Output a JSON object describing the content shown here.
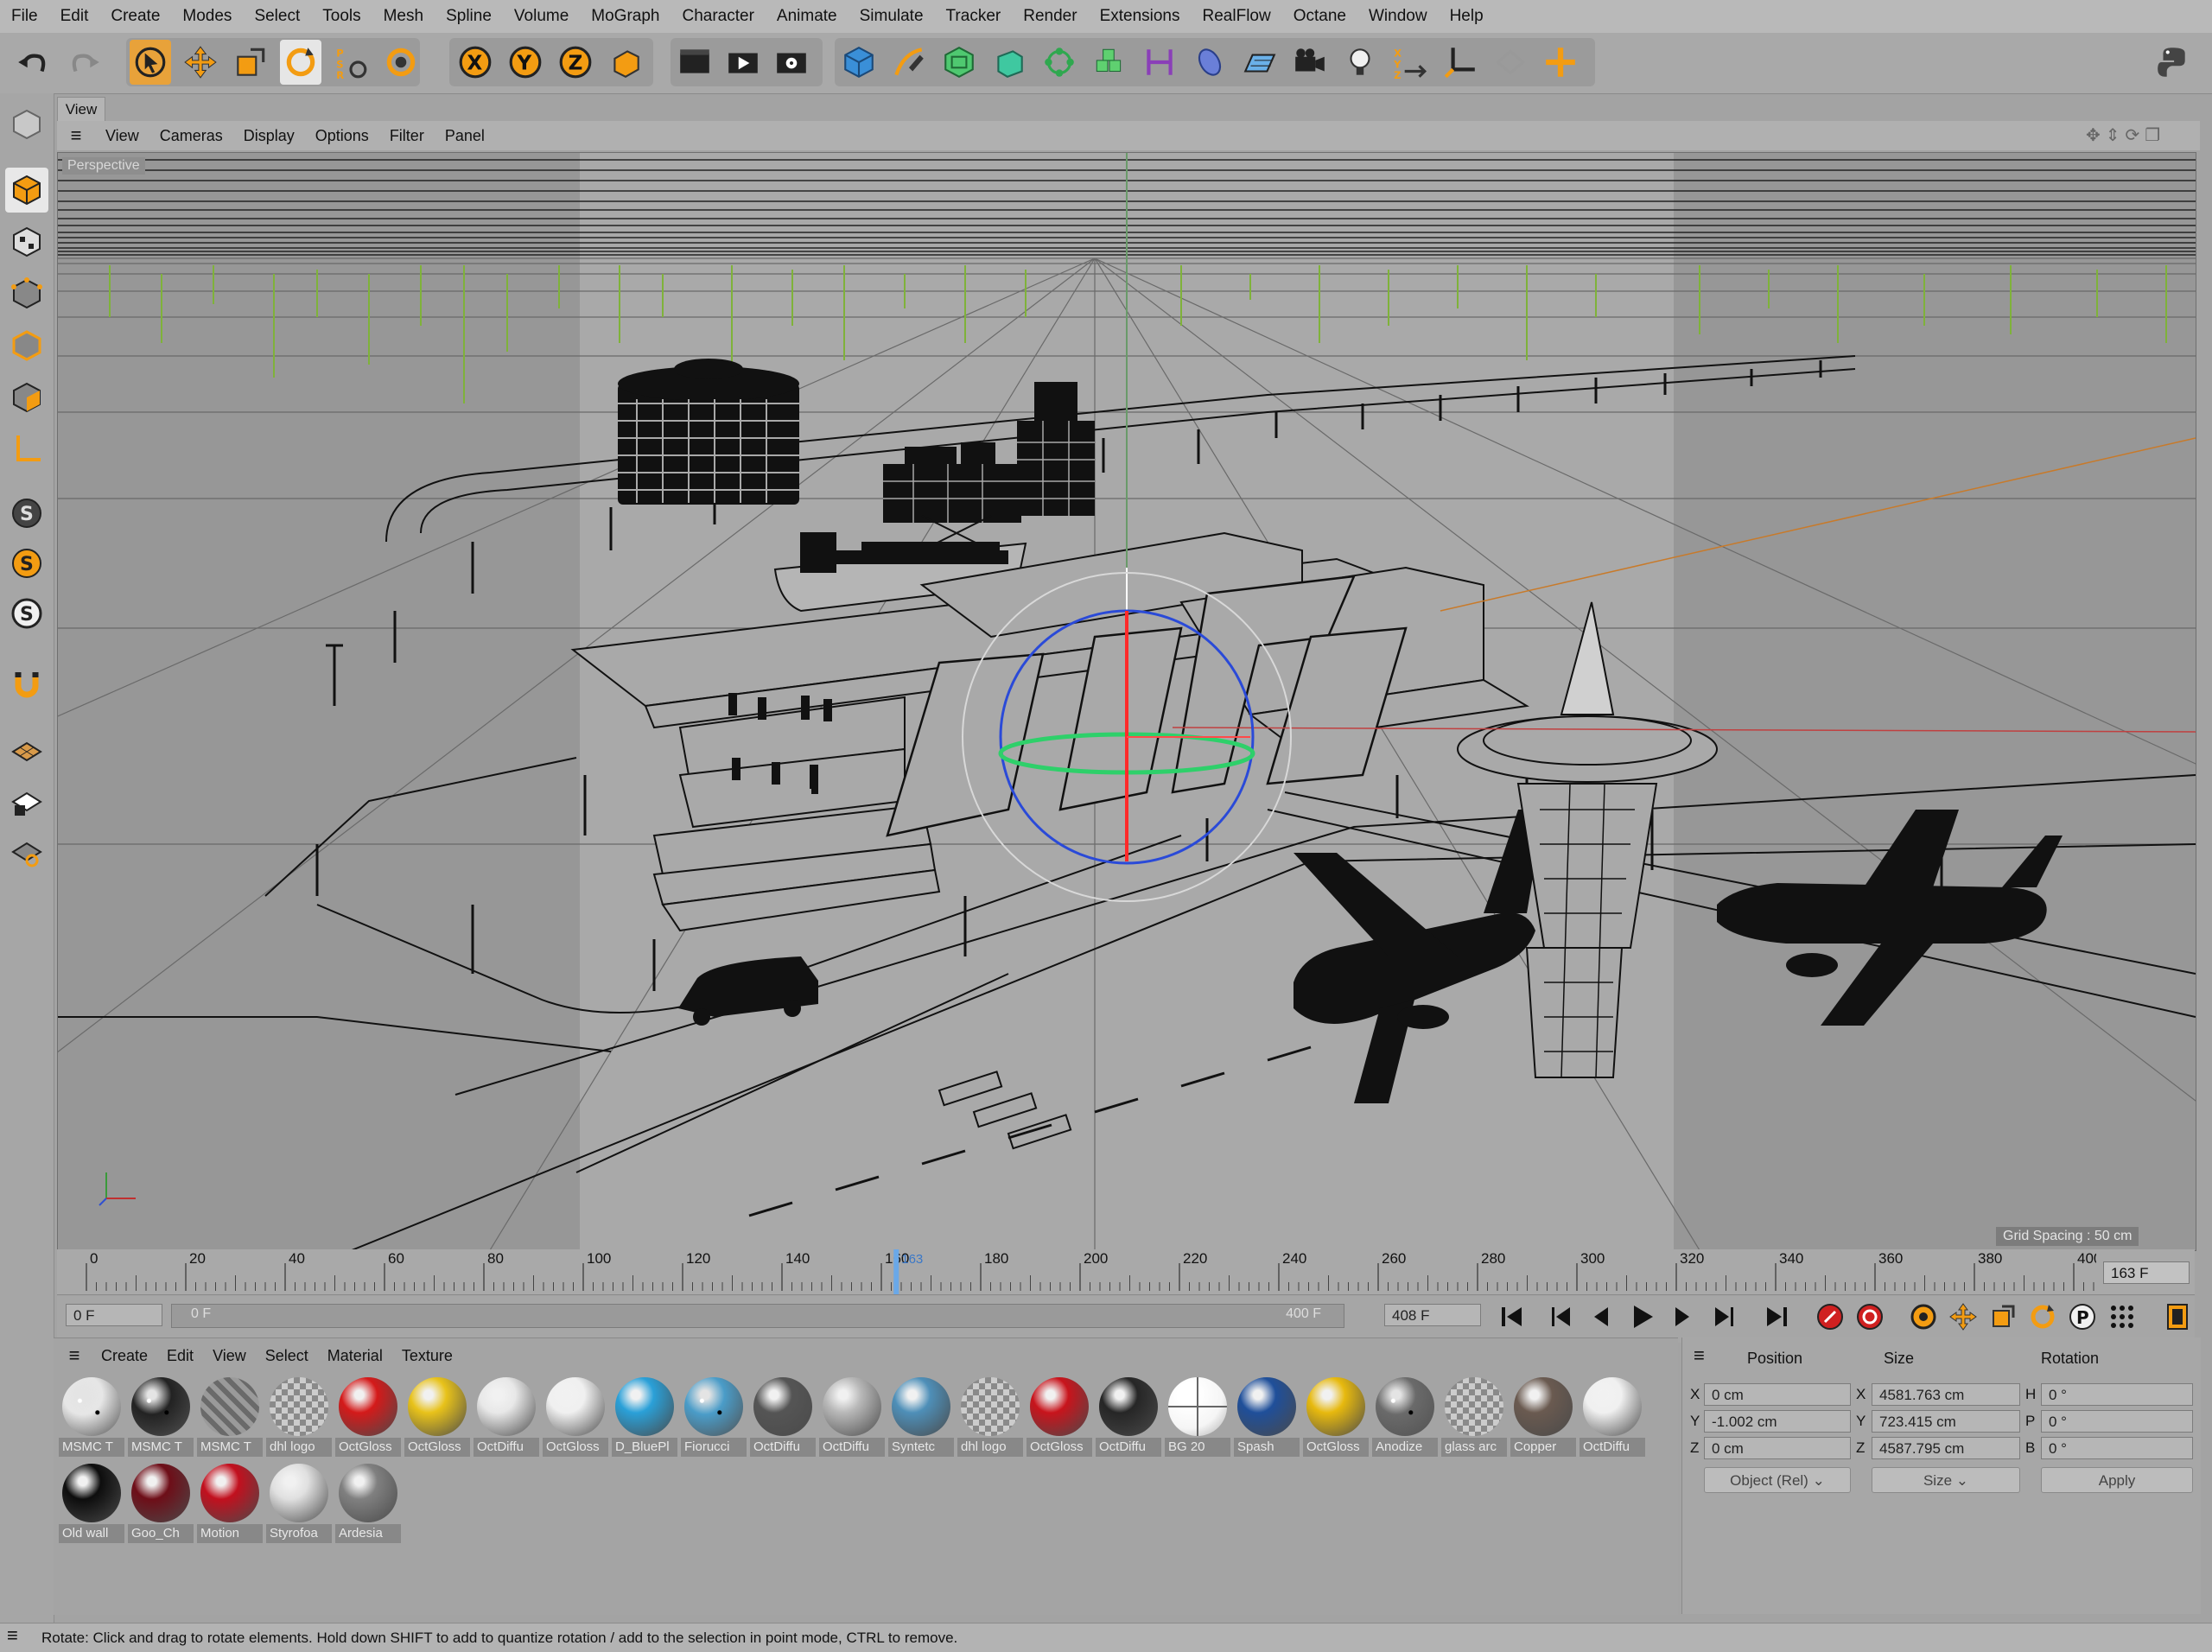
{
  "menubar": [
    "File",
    "Edit",
    "Create",
    "Modes",
    "Select",
    "Tools",
    "Mesh",
    "Spline",
    "Volume",
    "MoGraph",
    "Character",
    "Animate",
    "Simulate",
    "Tracker",
    "Render",
    "Extensions",
    "RealFlow",
    "Octane",
    "Window",
    "Help"
  ],
  "view": {
    "tab_label": "View",
    "menu": [
      "View",
      "Cameras",
      "Display",
      "Options",
      "Filter",
      "Panel"
    ],
    "viewport_label": "Perspective",
    "grid_spacing": "Grid Spacing : 50 cm"
  },
  "timeline": {
    "ticks": [
      "0",
      "20",
      "40",
      "60",
      "80",
      "100",
      "120",
      "140",
      "160",
      "180",
      "200",
      "220",
      "240",
      "260",
      "280",
      "300",
      "320",
      "340",
      "360",
      "380",
      "400"
    ],
    "playhead_value": "163",
    "current_frame": "163 F"
  },
  "transport": {
    "start_frame": "0 F",
    "range_start": "0 F",
    "range_end": "400 F",
    "end_frame": "408 F"
  },
  "materials": {
    "menu": [
      "Create",
      "Edit",
      "View",
      "Select",
      "Material",
      "Texture"
    ],
    "items": [
      {
        "label": "MSMC T",
        "color": "#e6e6e6",
        "pattern": "speckle"
      },
      {
        "label": "MSMC T",
        "color": "#222222",
        "pattern": "speckle"
      },
      {
        "label": "MSMC T",
        "color": "#7a7a7a",
        "pattern": "stripe"
      },
      {
        "label": "dhl logo",
        "color": "#cfcfcf",
        "pattern": "checker"
      },
      {
        "label": "OctGloss",
        "color": "#d41a1a",
        "pattern": "plain"
      },
      {
        "label": "OctGloss",
        "color": "#e8c21a",
        "pattern": "plain"
      },
      {
        "label": "OctDiffu",
        "color": "#e8e8e8",
        "pattern": "plain"
      },
      {
        "label": "OctGloss",
        "color": "#f0f0f0",
        "pattern": "plain"
      },
      {
        "label": "D_BluePl",
        "color": "#2aa0d8",
        "pattern": "plain"
      },
      {
        "label": "Fiorucci",
        "color": "#4a9cc8",
        "pattern": "speckle"
      },
      {
        "label": "OctDiffu",
        "color": "#555555",
        "pattern": "plain"
      },
      {
        "label": "OctDiffu",
        "color": "#b8b8b8",
        "pattern": "plain"
      },
      {
        "label": "Syntetc",
        "color": "#4e8fb8",
        "pattern": "plain"
      },
      {
        "label": "dhl logo",
        "color": "#cfcfcf",
        "pattern": "checker"
      },
      {
        "label": "OctGloss",
        "color": "#c8141c",
        "pattern": "plain"
      },
      {
        "label": "OctDiffu",
        "color": "#262626",
        "pattern": "plain"
      },
      {
        "label": "BG 20",
        "color": "#f5f5f5",
        "pattern": "cross"
      },
      {
        "label": "Spash",
        "color": "#1f4f9a",
        "pattern": "plain"
      },
      {
        "label": "OctGloss",
        "color": "#e7b90e",
        "pattern": "plain"
      },
      {
        "label": "Anodize",
        "color": "#6a6a6a",
        "pattern": "speckle"
      },
      {
        "label": "glass arc",
        "color": "#9aa3a8",
        "pattern": "checker"
      },
      {
        "label": "Copper",
        "color": "#6a5a50",
        "pattern": "plain"
      },
      {
        "label": "OctDiffu",
        "color": "#f0f0f0",
        "pattern": "plain"
      },
      {
        "label": "Old wall",
        "color": "#0d0d0d",
        "pattern": "plain"
      },
      {
        "label": "Goo_Ch",
        "color": "#6e0e18",
        "pattern": "plain"
      },
      {
        "label": "Motion",
        "color": "#c2101e",
        "pattern": "plain"
      },
      {
        "label": "Styrofoa",
        "color": "#e0e0e0",
        "pattern": "plain"
      },
      {
        "label": "Ardesia",
        "color": "#808080",
        "pattern": "plain"
      }
    ]
  },
  "attributes": {
    "headers": [
      "Position",
      "Size",
      "Rotation"
    ],
    "position": {
      "X": "0 cm",
      "Y": "-1.002 cm",
      "Z": "0 cm"
    },
    "size": {
      "X": "4581.763 cm",
      "Y": "723.415 cm",
      "Z": "4587.795 cm"
    },
    "rotation": {
      "H": "0 °",
      "P": "0 °",
      "B": "0 °"
    },
    "coord_mode": "Object (Rel)",
    "size_mode": "Size",
    "apply_label": "Apply"
  },
  "status": "Rotate: Click and drag to rotate elements. Hold down SHIFT to add to quantize rotation / add to the selection in point mode, CTRL to remove.",
  "colors": {
    "accent": "#f39c12",
    "x_axis": "#e03030",
    "y_axis": "#30c060",
    "z_axis": "#3060e0"
  }
}
